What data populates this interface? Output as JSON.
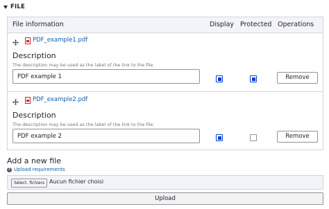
{
  "section": {
    "title": "FILE",
    "toggle_icon": "triangle-down-icon"
  },
  "table": {
    "headers": {
      "file_information": "File information",
      "display": "Display",
      "protected": "Protected",
      "operations": "Operations"
    },
    "rows": [
      {
        "file_name": "PDF_example1.pdf",
        "file_icon": "pdf-file-icon",
        "description_label": "Description",
        "description_help": "The description may be used as the label of the link to the file.",
        "description_value": "PDF example 1",
        "display": true,
        "protected": true,
        "remove_label": "Remove"
      },
      {
        "file_name": "PDF_example2.pdf",
        "file_icon": "pdf-file-icon",
        "description_label": "Description",
        "description_help": "The description may be used as the label of the link to the file.",
        "description_value": "PDF example 2",
        "display": true,
        "protected": false,
        "remove_label": "Remove"
      }
    ]
  },
  "add_file": {
    "title": "Add a new file",
    "upload_requirements_label": "Upload requirements",
    "browse_label": "Sélect. fichiers",
    "no_file_text": "Aucun fichier choisi",
    "upload_label": "Upload"
  },
  "colors": {
    "accent": "#003ecc",
    "link": "#0f5cb0",
    "header_bg": "#f3f4f9",
    "border": "#d4d4d8"
  }
}
